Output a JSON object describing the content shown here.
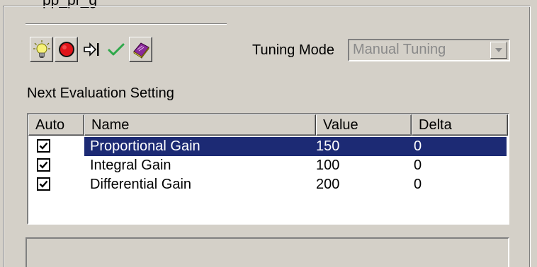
{
  "window": {
    "partial_title": "pp_pr_g"
  },
  "toolbar": {
    "buttons": [
      {
        "icon": "lightbulb-icon"
      },
      {
        "icon": "stop-icon"
      },
      {
        "icon": "step-icon"
      },
      {
        "icon": "checkmark-icon"
      },
      {
        "icon": "book-icon"
      }
    ]
  },
  "tuning": {
    "label": "Tuning Mode",
    "value": "Manual Tuning"
  },
  "evaluation": {
    "label": "Next Evaluation Setting",
    "columns": [
      "Auto",
      "Name",
      "Value",
      "Delta"
    ],
    "rows": [
      {
        "auto": true,
        "name": "Proportional Gain",
        "value": "150",
        "delta": "0",
        "selected": true
      },
      {
        "auto": true,
        "name": "Integral Gain",
        "value": "100",
        "delta": "0",
        "selected": false
      },
      {
        "auto": true,
        "name": "Differential Gain",
        "value": "200",
        "delta": "0",
        "selected": false
      }
    ]
  },
  "colors": {
    "background": "#d4d0c8",
    "selection": "#1c2a74",
    "disabled_text": "#8a8a8a"
  }
}
